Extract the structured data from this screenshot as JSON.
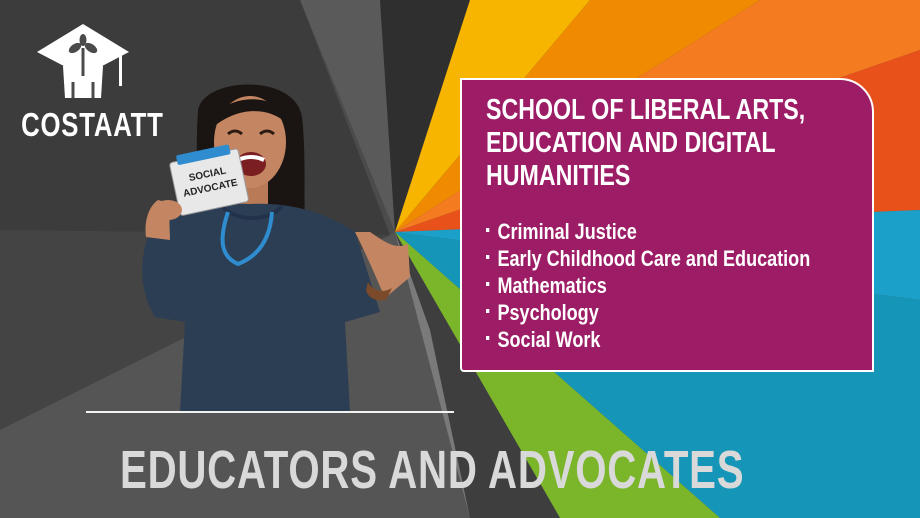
{
  "brand": {
    "name": "COSTAATT"
  },
  "badge": {
    "line1": "SOCIAL",
    "line2": "ADVOCATE"
  },
  "info_box": {
    "title_lines": [
      "SCHOOL OF LIBERAL ARTS,",
      "EDUCATION AND DIGITAL",
      "HUMANITIES"
    ],
    "programs": [
      "Criminal Justice",
      "Early Childhood Care and Education",
      "Mathematics",
      "Psychology",
      "Social Work"
    ]
  },
  "headline": "EDUCATORS AND ADVOCATES",
  "colors": {
    "box": "#9c1d66",
    "ray_yellow": "#f7b500",
    "ray_orange": "#f08a00",
    "ray_red_orange": "#e8521a",
    "ray_green": "#7bb52a",
    "ray_cyan": "#1a9fc2",
    "headline_text": "#d9d9d9"
  }
}
